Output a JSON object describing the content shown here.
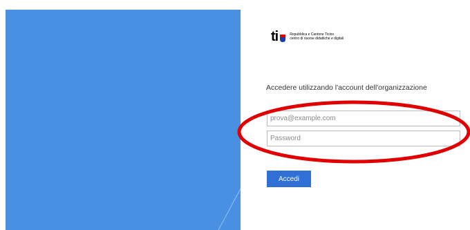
{
  "branding": {
    "logo_mark": "ti",
    "org_name_line1": "Repubblica e Cantone Ticino",
    "org_name_line2": "centro di risorse didattiche e digitali"
  },
  "login": {
    "heading": "Accedere utilizzando l'account dell'organizzazione",
    "email_placeholder": "prova@example.com",
    "password_placeholder": "Password",
    "submit_label": "Accedi"
  },
  "colors": {
    "left_panel": "#4a90e2",
    "button": "#2f6fd6",
    "annotation": "#e00000"
  }
}
